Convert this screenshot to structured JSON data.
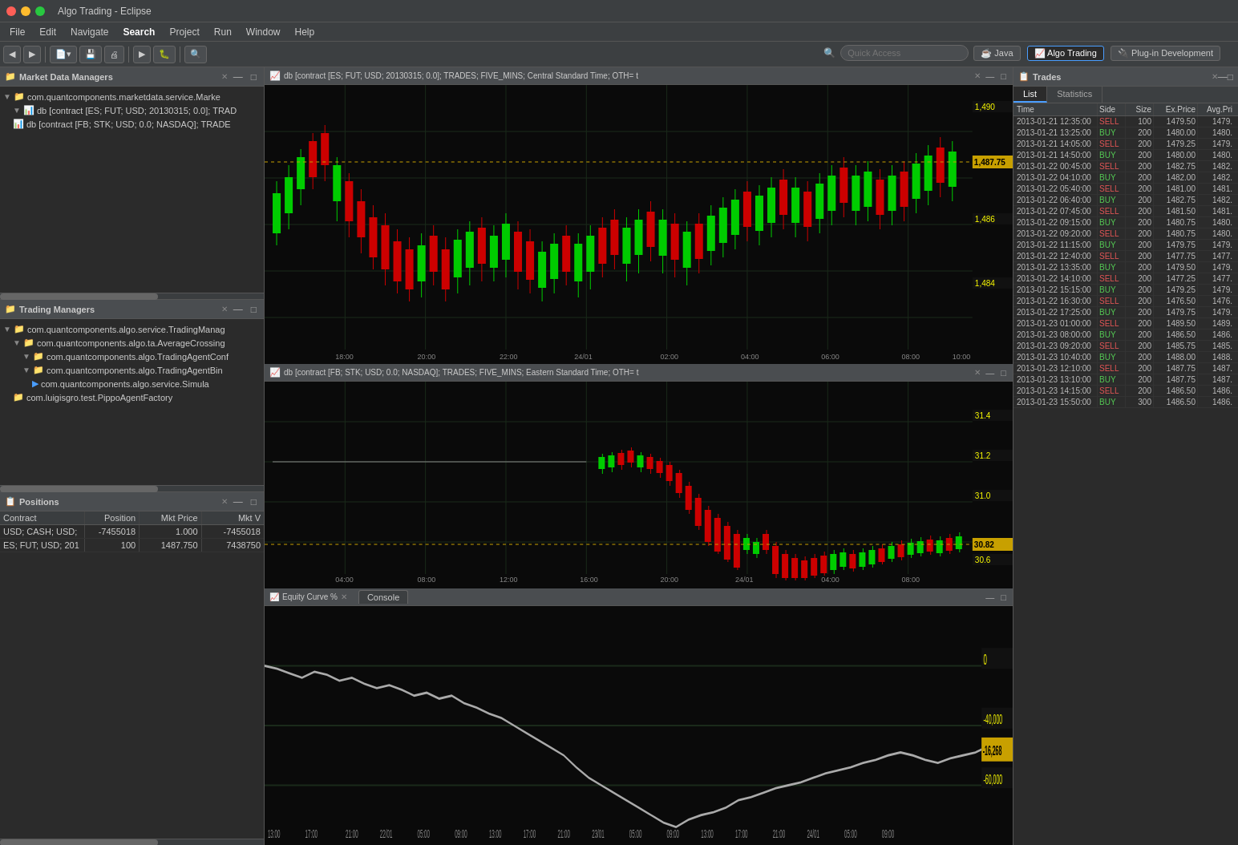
{
  "window": {
    "title": "Algo Trading - Eclipse"
  },
  "menu": {
    "items": [
      "File",
      "Edit",
      "Navigate",
      "Search",
      "Project",
      "Run",
      "Window",
      "Help"
    ]
  },
  "toolbar": {
    "quick_access_placeholder": "Quick Access"
  },
  "perspective_tabs": [
    {
      "label": "Java",
      "icon": "java-icon"
    },
    {
      "label": "Algo Trading",
      "icon": "chart-icon",
      "active": true
    },
    {
      "label": "Plug-in Development",
      "icon": "plugin-icon"
    }
  ],
  "market_data_panel": {
    "title": "Market Data Managers",
    "items": [
      {
        "label": "com.quantcomponents.marketdata.service.Marke",
        "indent": 1,
        "type": "folder"
      },
      {
        "label": "db [contract [ES; FUT; USD; 20130315; 0.0]; TRAD",
        "indent": 2,
        "type": "chart"
      },
      {
        "label": "db [contract [FB; STK; USD; 0.0; NASDAQ]; TRADE",
        "indent": 2,
        "type": "chart"
      }
    ]
  },
  "trading_panel": {
    "title": "Trading Managers",
    "items": [
      {
        "label": "com.quantcomponents.algo.service.TradingManag",
        "indent": 1,
        "type": "folder"
      },
      {
        "label": "com.quantcomponents.algo.ta.AverageCrossing",
        "indent": 2,
        "type": "folder"
      },
      {
        "label": "com.quantcomponents.algo.TradingAgentConf",
        "indent": 3,
        "type": "folder"
      },
      {
        "label": "com.quantcomponents.algo.TradingAgentBin",
        "indent": 3,
        "type": "folder"
      },
      {
        "label": "com.quantcomponents.algo.service.Simula",
        "indent": 4,
        "type": "arrow"
      },
      {
        "label": "com.luigisgro.test.PippoAgentFactory",
        "indent": 2,
        "type": "folder"
      }
    ]
  },
  "positions_panel": {
    "title": "Positions",
    "columns": [
      "Contract",
      "Position",
      "Mkt Price",
      "Mkt V"
    ],
    "rows": [
      {
        "contract": "USD; CASH; USD;",
        "position": "-7455018",
        "mktprice": "1.000",
        "mktv": "-7455018"
      },
      {
        "contract": "ES; FUT; USD; 201",
        "position": "100",
        "mktprice": "1487.750",
        "mktv": "7438750"
      }
    ]
  },
  "chart1": {
    "title": "db [contract [ES; FUT; USD; 20130315; 0.0]; TRADES; FIVE_MINS; Central Standard Time; OTH= t",
    "current_price": "1,487.75",
    "price_labels": [
      "1,490",
      "1,488",
      "1,486",
      "1,484"
    ],
    "time_labels": [
      "18:00",
      "20:00",
      "22:00",
      "24/01",
      "02:00",
      "04:00",
      "06:00",
      "08:00",
      "10:00"
    ]
  },
  "chart2": {
    "title": "db [contract [FB; STK; USD; 0.0; NASDAQ]; TRADES; FIVE_MINS; Eastern Standard Time; OTH= t",
    "current_price": "30.82",
    "price_labels": [
      "31.4",
      "31.2",
      "31.0",
      "30.82",
      "30.6"
    ],
    "time_labels": [
      "04:00",
      "08:00",
      "12:00",
      "16:00",
      "20:00",
      "24/01",
      "04:00",
      "08:00"
    ]
  },
  "equity_panel": {
    "title": "Equity Curve %",
    "console_tab": "Console",
    "price_labels": [
      "0",
      "-16,268",
      "-40,000",
      "-60,000"
    ],
    "time_labels": [
      "13:00",
      "17:00",
      "21:00",
      "22/01",
      "05:00",
      "09:00",
      "13:00",
      "17:00",
      "21:00",
      "23/01",
      "05:00",
      "09:00",
      "13:00",
      "17:00",
      "21:00",
      "24/01",
      "05:00",
      "09:00"
    ]
  },
  "trades_panel": {
    "title": "Trades",
    "tabs": [
      "List",
      "Statistics"
    ],
    "active_tab": "List",
    "columns": [
      "Time",
      "Side",
      "Size",
      "Ex.Price",
      "Avg.Pri"
    ],
    "rows": [
      {
        "time": "2013-01-21 12:35:00",
        "side": "SELL",
        "size": "100",
        "exprice": "1479.50",
        "avgpri": "1479."
      },
      {
        "time": "2013-01-21 13:25:00",
        "side": "BUY",
        "size": "200",
        "exprice": "1480.00",
        "avgpri": "1480."
      },
      {
        "time": "2013-01-21 14:05:00",
        "side": "SELL",
        "size": "200",
        "exprice": "1479.25",
        "avgpri": "1479."
      },
      {
        "time": "2013-01-21 14:50:00",
        "side": "BUY",
        "size": "200",
        "exprice": "1480.00",
        "avgpri": "1480."
      },
      {
        "time": "2013-01-22 00:45:00",
        "side": "SELL",
        "size": "200",
        "exprice": "1482.75",
        "avgpri": "1482."
      },
      {
        "time": "2013-01-22 04:10:00",
        "side": "BUY",
        "size": "200",
        "exprice": "1482.00",
        "avgpri": "1482."
      },
      {
        "time": "2013-01-22 05:40:00",
        "side": "SELL",
        "size": "200",
        "exprice": "1481.00",
        "avgpri": "1481."
      },
      {
        "time": "2013-01-22 06:40:00",
        "side": "BUY",
        "size": "200",
        "exprice": "1482.75",
        "avgpri": "1482."
      },
      {
        "time": "2013-01-22 07:45:00",
        "side": "SELL",
        "size": "200",
        "exprice": "1481.50",
        "avgpri": "1481."
      },
      {
        "time": "2013-01-22 09:15:00",
        "side": "BUY",
        "size": "200",
        "exprice": "1480.75",
        "avgpri": "1480."
      },
      {
        "time": "2013-01-22 09:20:00",
        "side": "SELL",
        "size": "200",
        "exprice": "1480.75",
        "avgpri": "1480."
      },
      {
        "time": "2013-01-22 11:15:00",
        "side": "BUY",
        "size": "200",
        "exprice": "1479.75",
        "avgpri": "1479."
      },
      {
        "time": "2013-01-22 12:40:00",
        "side": "SELL",
        "size": "200",
        "exprice": "1477.75",
        "avgpri": "1477."
      },
      {
        "time": "2013-01-22 13:35:00",
        "side": "BUY",
        "size": "200",
        "exprice": "1479.50",
        "avgpri": "1479."
      },
      {
        "time": "2013-01-22 14:10:00",
        "side": "SELL",
        "size": "200",
        "exprice": "1477.25",
        "avgpri": "1477."
      },
      {
        "time": "2013-01-22 15:15:00",
        "side": "BUY",
        "size": "200",
        "exprice": "1479.25",
        "avgpri": "1479."
      },
      {
        "time": "2013-01-22 16:30:00",
        "side": "SELL",
        "size": "200",
        "exprice": "1476.50",
        "avgpri": "1476."
      },
      {
        "time": "2013-01-22 17:25:00",
        "side": "BUY",
        "size": "200",
        "exprice": "1479.75",
        "avgpri": "1479."
      },
      {
        "time": "2013-01-23 01:00:00",
        "side": "SELL",
        "size": "200",
        "exprice": "1489.50",
        "avgpri": "1489."
      },
      {
        "time": "2013-01-23 08:00:00",
        "side": "BUY",
        "size": "200",
        "exprice": "1486.50",
        "avgpri": "1486."
      },
      {
        "time": "2013-01-23 09:20:00",
        "side": "SELL",
        "size": "200",
        "exprice": "1485.75",
        "avgpri": "1485."
      },
      {
        "time": "2013-01-23 10:40:00",
        "side": "BUY",
        "size": "200",
        "exprice": "1488.00",
        "avgpri": "1488."
      },
      {
        "time": "2013-01-23 12:10:00",
        "side": "SELL",
        "size": "200",
        "exprice": "1487.75",
        "avgpri": "1487."
      },
      {
        "time": "2013-01-23 13:10:00",
        "side": "BUY",
        "size": "200",
        "exprice": "1487.75",
        "avgpri": "1487."
      },
      {
        "time": "2013-01-23 14:15:00",
        "side": "SELL",
        "size": "200",
        "exprice": "1486.50",
        "avgpri": "1486."
      },
      {
        "time": "2013-01-23 15:50:00",
        "side": "BUY",
        "size": "300",
        "exprice": "1486.50",
        "avgpri": "1486."
      }
    ]
  }
}
